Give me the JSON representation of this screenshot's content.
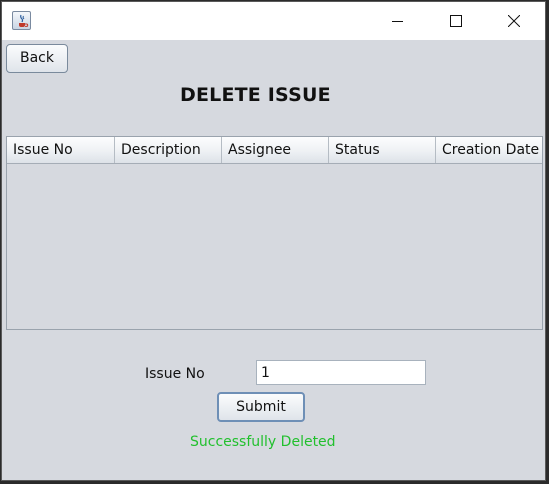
{
  "window": {
    "app_icon": "java-icon",
    "controls": {
      "minimize_icon": "minimize-icon",
      "maximize_icon": "maximize-icon",
      "close_icon": "close-icon"
    }
  },
  "toolbar": {
    "back_label": "Back"
  },
  "page": {
    "title": "DELETE ISSUE"
  },
  "table": {
    "columns": [
      "Issue No",
      "Description",
      "Assignee",
      "Status",
      "Creation Date"
    ],
    "rows": []
  },
  "form": {
    "issue_no_label": "Issue No",
    "issue_no_value": "1",
    "submit_label": "Submit"
  },
  "status": {
    "message": "Successfully Deleted",
    "color": "#22c02e"
  },
  "colors": {
    "window_bg": "#d6d9df",
    "button_focus_border": "#6e8fb6"
  }
}
